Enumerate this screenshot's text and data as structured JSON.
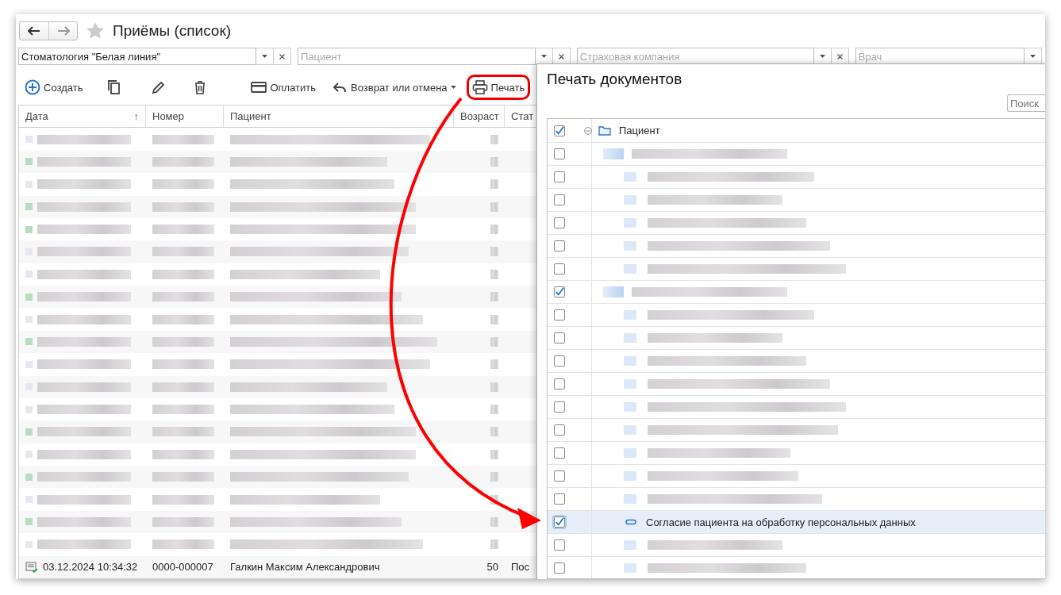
{
  "window": {
    "title": "Приёмы (список)",
    "favorite": false
  },
  "filters": [
    {
      "value": "Стоматология \"Белая линия\""
    },
    {
      "placeholder": "Пациент"
    },
    {
      "placeholder": "Страховая компания"
    },
    {
      "placeholder": "Врач"
    }
  ],
  "toolbar": [
    {
      "kind": "create",
      "label": "Создать"
    },
    {
      "kind": "copy"
    },
    {
      "kind": "edit"
    },
    {
      "kind": "delete"
    },
    {
      "kind": "pay",
      "label": "Оплатить"
    },
    {
      "kind": "return",
      "label": "Возврат или отмена"
    },
    {
      "kind": "print",
      "label": "Печать",
      "highlighted": true
    }
  ],
  "table": {
    "columns": [
      "Дата",
      "Номер",
      "Пациент",
      "Возраст",
      "Стат"
    ],
    "sort_arrow": "↑",
    "rows": [
      {
        "kind": "redacted",
        "marked": false
      },
      {
        "kind": "redacted",
        "marked": true
      },
      {
        "kind": "redacted",
        "marked": false
      },
      {
        "kind": "redacted",
        "marked": true
      },
      {
        "kind": "redacted",
        "marked": true
      },
      {
        "kind": "redacted",
        "marked": false
      },
      {
        "kind": "redacted",
        "marked": false
      },
      {
        "kind": "redacted",
        "marked": true
      },
      {
        "kind": "redacted",
        "marked": false
      },
      {
        "kind": "redacted",
        "marked": true
      },
      {
        "kind": "redacted",
        "marked": false
      },
      {
        "kind": "redacted",
        "marked": false
      },
      {
        "kind": "redacted",
        "marked": false
      },
      {
        "kind": "redacted",
        "marked": true
      },
      {
        "kind": "redacted",
        "marked": false
      },
      {
        "kind": "redacted",
        "marked": true
      },
      {
        "kind": "redacted",
        "marked": false
      },
      {
        "kind": "redacted",
        "marked": true
      },
      {
        "kind": "redacted",
        "marked": false
      },
      {
        "kind": "entry",
        "date": "03.12.2024 10:34:32",
        "number": "0000-000007",
        "patient": "Галкин Максим Александрович",
        "age": "50",
        "status": "Пос"
      }
    ]
  },
  "dialog": {
    "title": "Печать документов",
    "search": {
      "placeholder": "Поиск"
    },
    "tree": {
      "label": "Пациент",
      "checked": true,
      "expanded": true,
      "children": [
        {
          "kind": "redacted",
          "checked": false,
          "selected": false,
          "children": [
            {
              "kind": "redacted",
              "checked": false,
              "selected": false
            },
            {
              "kind": "redacted",
              "checked": false,
              "selected": false
            },
            {
              "kind": "redacted",
              "checked": false,
              "selected": false
            },
            {
              "kind": "redacted",
              "checked": false,
              "selected": false
            },
            {
              "kind": "redacted",
              "checked": false,
              "selected": false
            }
          ]
        },
        {
          "kind": "redacted",
          "checked": true,
          "selected": false,
          "children": [
            {
              "kind": "redacted",
              "checked": false,
              "selected": false
            },
            {
              "kind": "redacted",
              "checked": false,
              "selected": false
            },
            {
              "kind": "redacted",
              "checked": false,
              "selected": false
            },
            {
              "kind": "redacted",
              "checked": false,
              "selected": false
            },
            {
              "kind": "redacted",
              "checked": false,
              "selected": false
            },
            {
              "kind": "redacted",
              "checked": false,
              "selected": false
            },
            {
              "kind": "redacted",
              "checked": false,
              "selected": false
            },
            {
              "kind": "redacted",
              "checked": false,
              "selected": false
            },
            {
              "kind": "redacted",
              "checked": false,
              "selected": false
            },
            {
              "kind": "document",
              "label": "Согласие пациента на обработку персональных данных",
              "checked": true,
              "selected": true
            },
            {
              "kind": "redacted",
              "checked": false,
              "selected": false
            },
            {
              "kind": "redacted",
              "checked": false,
              "selected": false
            }
          ]
        }
      ]
    }
  },
  "annotation_arrow": true
}
